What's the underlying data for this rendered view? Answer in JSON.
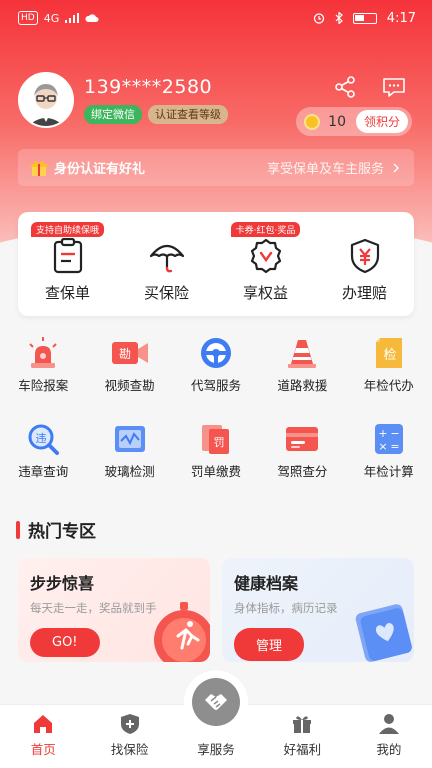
{
  "status_bar": {
    "left": "4G",
    "time": "4:17"
  },
  "profile": {
    "phone": "139****2580",
    "tag_wechat": "绑定微信",
    "tag_auth": "认证查看等级",
    "points": "10",
    "get_points": "领积分"
  },
  "gift_bar": {
    "title": "身份认证有好礼",
    "subtitle": "享受保单及车主服务"
  },
  "main_actions": [
    {
      "label": "查保单",
      "badge": "支持自助续保哦"
    },
    {
      "label": "买保险",
      "badge": ""
    },
    {
      "label": "享权益",
      "badge": "卡券·红包·奖品"
    },
    {
      "label": "办理赔",
      "badge": ""
    }
  ],
  "services": [
    {
      "label": "车险报案",
      "icon": "siren-icon"
    },
    {
      "label": "视频查勘",
      "icon": "video-camera-icon"
    },
    {
      "label": "代驾服务",
      "icon": "steering-wheel-icon"
    },
    {
      "label": "道路救援",
      "icon": "traffic-cone-icon"
    },
    {
      "label": "年检代办",
      "icon": "inspection-icon"
    },
    {
      "label": "违章查询",
      "icon": "magnifier-icon"
    },
    {
      "label": "玻璃检测",
      "icon": "glass-icon"
    },
    {
      "label": "罚单缴费",
      "icon": "ticket-icon"
    },
    {
      "label": "驾照查分",
      "icon": "license-icon"
    },
    {
      "label": "年检计算",
      "icon": "calculator-icon"
    }
  ],
  "section_title": "热门专区",
  "promos": [
    {
      "title": "步步惊喜",
      "subtitle": "每天走一走，奖品就到手",
      "button": "GO!"
    },
    {
      "title": "健康档案",
      "subtitle": "身体指标，病历记录",
      "button": "管理"
    }
  ],
  "tabs": [
    {
      "label": "首页"
    },
    {
      "label": "找保险"
    },
    {
      "label": "享服务"
    },
    {
      "label": "好福利"
    },
    {
      "label": "我的"
    }
  ],
  "colors": {
    "brand": "#f03a3a",
    "wechat": "#3cb55d",
    "auth": "#d9b58d"
  }
}
